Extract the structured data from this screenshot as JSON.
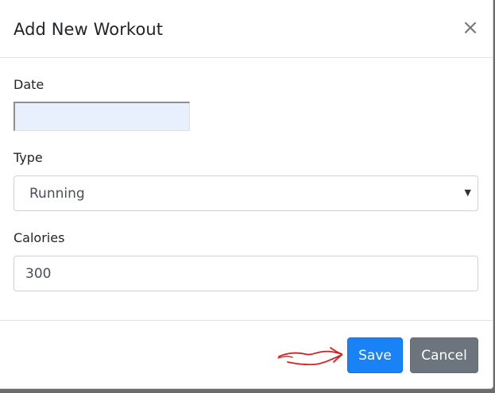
{
  "modal": {
    "title": "Add New Workout",
    "close_icon": "×"
  },
  "form": {
    "date": {
      "label": "Date",
      "value": ""
    },
    "type": {
      "label": "Type",
      "selected": "Running",
      "arrow": "▼"
    },
    "calories": {
      "label": "Calories",
      "value": "300"
    }
  },
  "footer": {
    "save_label": "Save",
    "cancel_label": "Cancel"
  },
  "colors": {
    "primary": "#1a82f7",
    "secondary": "#6c757d",
    "annotation": "#d42020",
    "date_field_bg": "#e8f0fe"
  },
  "icons": {
    "close": "close-icon",
    "dropdown": "chevron-down-icon",
    "annotation": "arrow-annotation-icon"
  }
}
